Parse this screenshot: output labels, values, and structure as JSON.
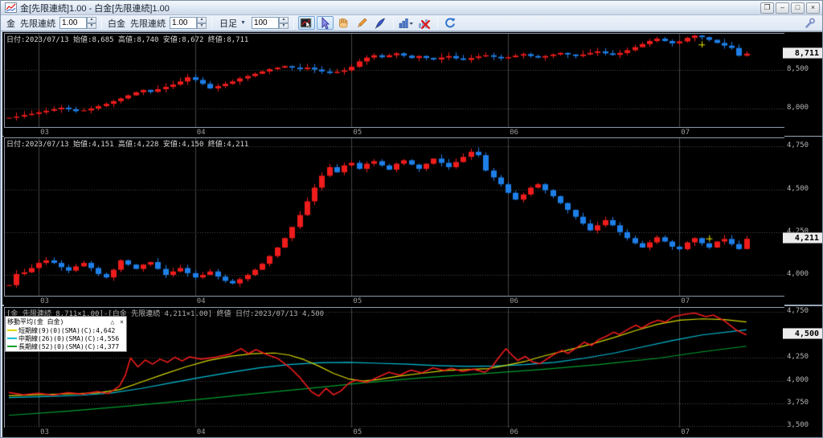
{
  "window": {
    "title": "金[先限連続]1.00 - 白金[先限連続]1.00",
    "buttons": {
      "float": "❐",
      "minimize": "–",
      "maximize": "□",
      "close": "×"
    }
  },
  "toolbar": {
    "instruments": [
      {
        "label": "金",
        "contract": "先限連続",
        "multiplier": "1.00"
      },
      {
        "label": "白金",
        "contract": "先限連続",
        "multiplier": "1.00"
      }
    ],
    "timeframe": {
      "label": "日足",
      "dropdown_arrow": "▼",
      "bars": "100"
    },
    "tools": [
      {
        "name": "chart-select-tool",
        "selected": true
      },
      {
        "name": "cursor-tool",
        "selected": true
      },
      {
        "name": "pan-hand-tool",
        "selected": false
      },
      {
        "name": "pencil-tool",
        "selected": false
      },
      {
        "name": "pen-annotate-tool",
        "selected": false
      },
      {
        "name": "indicator-dropdown",
        "selected": false
      },
      {
        "name": "delete-indicator",
        "selected": false
      },
      {
        "name": "refresh",
        "selected": false
      },
      {
        "name": "settings-wrench",
        "selected": false
      }
    ]
  },
  "colors": {
    "up": "#ee1c1c",
    "down": "#1e7fe8",
    "ma_short": "#d9d900",
    "ma_mid": "#00c0d8",
    "ma_long": "#00a030",
    "spread": "#ee1c1c",
    "marker": "#e8e800",
    "grid_h": "#4d4d4d",
    "grid_v": "#464646"
  },
  "chart_data": [
    {
      "type": "candlestick",
      "symbol": "金 先限連続",
      "header": "日付:2023/07/13 始値:8,685 高値:8,740 安値:8,672 終値:8,711",
      "final_ohlc": {
        "open": 8685,
        "high": 8740,
        "low": 8672,
        "close": 8711
      },
      "last_price": 8711,
      "last_price_label": "8,711",
      "ylim": [
        7760,
        8969
      ],
      "y_ticks": [
        {
          "value": 8500,
          "label": "8,500"
        },
        {
          "value": 8000,
          "label": "8,000"
        }
      ],
      "x_ticks": [
        {
          "index": 4,
          "label": "03"
        },
        {
          "index": 25,
          "label": "04"
        },
        {
          "index": 46,
          "label": "05"
        },
        {
          "index": 67,
          "label": "06"
        },
        {
          "index": 90,
          "label": "07"
        }
      ],
      "marker": {
        "index": 93,
        "value": 8830
      },
      "overrides": [
        {
          "i": 99,
          "high": 8740,
          "low": 8672
        }
      ],
      "closes": [
        7880,
        7895,
        7915,
        7930,
        7950,
        7970,
        7990,
        8010,
        7990,
        7965,
        7975,
        8000,
        8030,
        8060,
        8095,
        8130,
        8170,
        8210,
        8240,
        8215,
        8250,
        8280,
        8310,
        8350,
        8405,
        8370,
        8320,
        8260,
        8290,
        8320,
        8350,
        8390,
        8420,
        8450,
        8480,
        8510,
        8530,
        8550,
        8530,
        8510,
        8530,
        8505,
        8480,
        8460,
        8475,
        8495,
        8540,
        8610,
        8660,
        8690,
        8665,
        8690,
        8715,
        8685,
        8655,
        8680,
        8655,
        8635,
        8660,
        8680,
        8650,
        8630,
        8655,
        8675,
        8690,
        8670,
        8650,
        8665,
        8685,
        8705,
        8680,
        8660,
        8680,
        8700,
        8720,
        8700,
        8680,
        8700,
        8720,
        8740,
        8715,
        8695,
        8720,
        8755,
        8795,
        8835,
        8875,
        8905,
        8875,
        8845,
        8870,
        8915,
        8945,
        8925,
        8890,
        8850,
        8815,
        8785,
        8685,
        8711
      ]
    },
    {
      "type": "candlestick",
      "symbol": "白金 先限連続",
      "header": "日付:2023/07/13 始値:4,151 高値:4,228 安値:4,150 終値:4,211",
      "final_ohlc": {
        "open": 4151,
        "high": 4228,
        "low": 4150,
        "close": 4211
      },
      "last_price": 4211,
      "last_price_label": "4,211",
      "ylim": [
        3878,
        4799
      ],
      "y_ticks": [
        {
          "value": 4750,
          "label": "4,750"
        },
        {
          "value": 4500,
          "label": "4,500"
        },
        {
          "value": 4250,
          "label": "4,250"
        },
        {
          "value": 4000,
          "label": "4,000"
        }
      ],
      "x_ticks": [
        {
          "index": 4,
          "label": "03"
        },
        {
          "index": 25,
          "label": "04"
        },
        {
          "index": 46,
          "label": "05"
        },
        {
          "index": 67,
          "label": "06"
        },
        {
          "index": 90,
          "label": "07"
        }
      ],
      "marker": {
        "index": 94,
        "value": 4213
      },
      "overrides": [
        {
          "i": 63,
          "high": 4745
        },
        {
          "i": 99,
          "high": 4228,
          "low": 4150
        }
      ],
      "closes": [
        3940,
        4005,
        4015,
        4040,
        4070,
        4085,
        4070,
        4045,
        4025,
        4050,
        4070,
        4040,
        4005,
        3985,
        4030,
        4085,
        4060,
        4035,
        4060,
        4075,
        4035,
        4000,
        4020,
        4040,
        4010,
        3985,
        4000,
        4020,
        3990,
        3965,
        3950,
        3975,
        4000,
        4030,
        4065,
        4110,
        4160,
        4215,
        4280,
        4350,
        4430,
        4510,
        4580,
        4630,
        4600,
        4640,
        4655,
        4620,
        4650,
        4665,
        4640,
        4615,
        4650,
        4670,
        4645,
        4620,
        4650,
        4680,
        4655,
        4630,
        4660,
        4690,
        4720,
        4700,
        4610,
        4570,
        4530,
        4480,
        4440,
        4470,
        4510,
        4530,
        4495,
        4460,
        4420,
        4380,
        4340,
        4300,
        4260,
        4290,
        4320,
        4290,
        4250,
        4215,
        4185,
        4160,
        4190,
        4220,
        4195,
        4165,
        4150,
        4190,
        4215,
        4185,
        4160,
        4195,
        4210,
        4180,
        4151,
        4211
      ]
    },
    {
      "type": "line",
      "header": "[金 先限連続 8,711×1.00]-[白金 先限連続 4,211×1.00] 終値 日付:2023/07/13 4,500",
      "last_price": 4500,
      "last_price_label": "4,500",
      "ylim": [
        3477,
        4797
      ],
      "y_ticks": [
        {
          "value": 4750,
          "label": "4,750"
        },
        {
          "value": 4250,
          "label": "4,250"
        },
        {
          "value": 4000,
          "label": "4,000"
        },
        {
          "value": 3750,
          "label": "3,750"
        },
        {
          "value": 3500,
          "label": "3,500"
        }
      ],
      "x_ticks": [
        {
          "index": 4,
          "label": "03"
        },
        {
          "index": 25,
          "label": "04"
        },
        {
          "index": 46,
          "label": "05"
        },
        {
          "index": 67,
          "label": "06"
        },
        {
          "index": 90,
          "label": "07"
        }
      ],
      "legend": {
        "title": "移動平均(金 白金)",
        "collapse_btn": "△",
        "close_btn": "×",
        "items": [
          {
            "label": "短期線(9)(0)(SMA)(C):4,642",
            "color": "#d9d900",
            "value": 4642
          },
          {
            "label": "中期線(26)(0)(SMA)(C):4,556",
            "color": "#00c0d8",
            "value": 4556
          },
          {
            "label": "長期線(52)(0)(SMA)(C):4,377",
            "color": "#00a030",
            "value": 4377
          }
        ]
      },
      "series": [
        {
          "name": "ma-long",
          "color": "#00a030",
          "width": 1.2,
          "points": [
            [
              0,
              3620
            ],
            [
              0.08,
              3665
            ],
            [
              0.16,
              3720
            ],
            [
              0.24,
              3780
            ],
            [
              0.32,
              3845
            ],
            [
              0.4,
              3910
            ],
            [
              0.48,
              3975
            ],
            [
              0.56,
              4030
            ],
            [
              0.64,
              4075
            ],
            [
              0.72,
              4120
            ],
            [
              0.8,
              4175
            ],
            [
              0.88,
              4245
            ],
            [
              0.94,
              4315
            ],
            [
              1,
              4377
            ]
          ]
        },
        {
          "name": "ma-mid",
          "color": "#00c0d8",
          "width": 1.2,
          "points": [
            [
              0,
              3815
            ],
            [
              0.05,
              3825
            ],
            [
              0.1,
              3840
            ],
            [
              0.14,
              3865
            ],
            [
              0.18,
              3915
            ],
            [
              0.22,
              3975
            ],
            [
              0.26,
              4035
            ],
            [
              0.3,
              4090
            ],
            [
              0.34,
              4140
            ],
            [
              0.38,
              4175
            ],
            [
              0.42,
              4195
            ],
            [
              0.46,
              4200
            ],
            [
              0.5,
              4190
            ],
            [
              0.54,
              4180
            ],
            [
              0.58,
              4165
            ],
            [
              0.62,
              4155
            ],
            [
              0.66,
              4160
            ],
            [
              0.7,
              4175
            ],
            [
              0.74,
              4200
            ],
            [
              0.78,
              4245
            ],
            [
              0.82,
              4300
            ],
            [
              0.86,
              4370
            ],
            [
              0.9,
              4440
            ],
            [
              0.94,
              4500
            ],
            [
              1,
              4556
            ]
          ]
        },
        {
          "name": "ma-short",
          "color": "#d9d900",
          "width": 1.2,
          "points": [
            [
              0,
              3835
            ],
            [
              0.04,
              3845
            ],
            [
              0.08,
              3855
            ],
            [
              0.12,
              3865
            ],
            [
              0.15,
              3900
            ],
            [
              0.18,
              3985
            ],
            [
              0.21,
              4070
            ],
            [
              0.24,
              4150
            ],
            [
              0.27,
              4220
            ],
            [
              0.3,
              4265
            ],
            [
              0.33,
              4295
            ],
            [
              0.36,
              4302
            ],
            [
              0.38,
              4280
            ],
            [
              0.4,
              4230
            ],
            [
              0.42,
              4160
            ],
            [
              0.44,
              4080
            ],
            [
              0.46,
              4020
            ],
            [
              0.48,
              3995
            ],
            [
              0.5,
              4010
            ],
            [
              0.53,
              4050
            ],
            [
              0.56,
              4080
            ],
            [
              0.59,
              4110
            ],
            [
              0.62,
              4120
            ],
            [
              0.65,
              4132
            ],
            [
              0.67,
              4160
            ],
            [
              0.7,
              4210
            ],
            [
              0.72,
              4258
            ],
            [
              0.74,
              4300
            ],
            [
              0.76,
              4338
            ],
            [
              0.79,
              4400
            ],
            [
              0.82,
              4470
            ],
            [
              0.85,
              4548
            ],
            [
              0.88,
              4618
            ],
            [
              0.91,
              4662
            ],
            [
              0.94,
              4676
            ],
            [
              0.97,
              4668
            ],
            [
              1,
              4642
            ]
          ]
        },
        {
          "name": "spread-gold-minus-platinum",
          "color": "#ee1c1c",
          "width": 1.6,
          "points": [
            [
              0,
              3870
            ],
            [
              0.02,
              3845
            ],
            [
              0.04,
              3862
            ],
            [
              0.06,
              3840
            ],
            [
              0.08,
              3868
            ],
            [
              0.1,
              3852
            ],
            [
              0.12,
              3880
            ],
            [
              0.135,
              3858
            ],
            [
              0.15,
              3940
            ],
            [
              0.158,
              4060
            ],
            [
              0.165,
              4250
            ],
            [
              0.175,
              4150
            ],
            [
              0.185,
              4225
            ],
            [
              0.195,
              4180
            ],
            [
              0.205,
              4235
            ],
            [
              0.215,
              4200
            ],
            [
              0.225,
              4255
            ],
            [
              0.235,
              4215
            ],
            [
              0.245,
              4260
            ],
            [
              0.26,
              4235
            ],
            [
              0.28,
              4255
            ],
            [
              0.3,
              4290
            ],
            [
              0.315,
              4350
            ],
            [
              0.325,
              4295
            ],
            [
              0.335,
              4340
            ],
            [
              0.35,
              4285
            ],
            [
              0.365,
              4240
            ],
            [
              0.38,
              4150
            ],
            [
              0.395,
              4030
            ],
            [
              0.41,
              3880
            ],
            [
              0.42,
              3830
            ],
            [
              0.43,
              3915
            ],
            [
              0.44,
              3845
            ],
            [
              0.45,
              3885
            ],
            [
              0.46,
              3965
            ],
            [
              0.47,
              4005
            ],
            [
              0.485,
              3980
            ],
            [
              0.5,
              4035
            ],
            [
              0.515,
              4090
            ],
            [
              0.53,
              4060
            ],
            [
              0.545,
              4115
            ],
            [
              0.56,
              4085
            ],
            [
              0.575,
              4140
            ],
            [
              0.59,
              4110
            ],
            [
              0.6,
              4135
            ],
            [
              0.615,
              4100
            ],
            [
              0.63,
              4125
            ],
            [
              0.645,
              4090
            ],
            [
              0.655,
              4150
            ],
            [
              0.662,
              4230
            ],
            [
              0.668,
              4290
            ],
            [
              0.674,
              4350
            ],
            [
              0.682,
              4280
            ],
            [
              0.69,
              4220
            ],
            [
              0.7,
              4265
            ],
            [
              0.71,
              4205
            ],
            [
              0.72,
              4185
            ],
            [
              0.73,
              4240
            ],
            [
              0.74,
              4290
            ],
            [
              0.75,
              4330
            ],
            [
              0.758,
              4298
            ],
            [
              0.77,
              4360
            ],
            [
              0.78,
              4420
            ],
            [
              0.79,
              4385
            ],
            [
              0.8,
              4450
            ],
            [
              0.81,
              4485
            ],
            [
              0.82,
              4530
            ],
            [
              0.828,
              4505
            ],
            [
              0.84,
              4565
            ],
            [
              0.85,
              4605
            ],
            [
              0.858,
              4575
            ],
            [
              0.87,
              4630
            ],
            [
              0.88,
              4660
            ],
            [
              0.89,
              4640
            ],
            [
              0.9,
              4695
            ],
            [
              0.915,
              4725
            ],
            [
              0.93,
              4740
            ],
            [
              0.945,
              4700
            ],
            [
              0.955,
              4718
            ],
            [
              0.97,
              4655
            ],
            [
              0.985,
              4560
            ],
            [
              1,
              4500
            ]
          ]
        }
      ]
    }
  ]
}
